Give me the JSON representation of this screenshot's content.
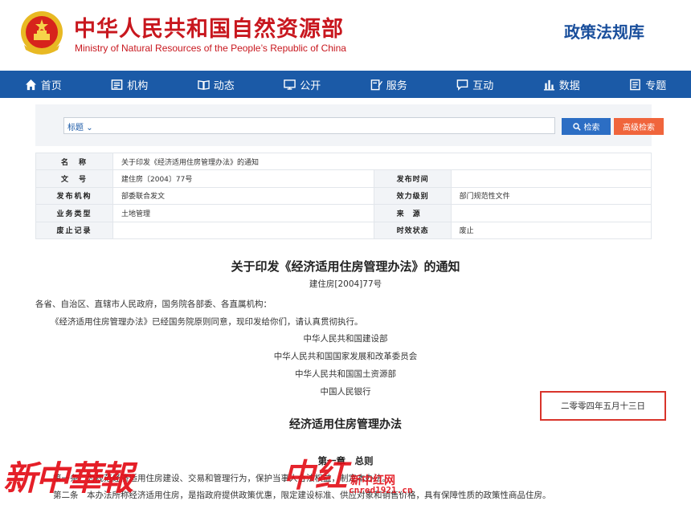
{
  "header": {
    "title_cn": "中华人民共和国自然资源部",
    "title_en": "Ministry of Natural Resources of the People’s Republic of China",
    "site_name": "政策法规库",
    "brand_color": "#c8171e"
  },
  "nav": {
    "color": "#1b5aa7",
    "items": [
      {
        "label": "首页",
        "icon": "home-icon"
      },
      {
        "label": "机构",
        "icon": "org-icon"
      },
      {
        "label": "动态",
        "icon": "book-icon"
      },
      {
        "label": "公开",
        "icon": "monitor-icon"
      },
      {
        "label": "服务",
        "icon": "edit-icon"
      },
      {
        "label": "互动",
        "icon": "chat-icon"
      },
      {
        "label": "数据",
        "icon": "bar-chart-icon"
      },
      {
        "label": "专题",
        "icon": "document-icon"
      }
    ]
  },
  "search": {
    "type_label": "标题",
    "value": "",
    "button_label": "检索",
    "advanced_label": "高级检索"
  },
  "meta": {
    "name_key": "名　称",
    "name_value": "关于印发《经济适用住房管理办法》的通知",
    "docno_key": "文　号",
    "docno_value": "建住房〔2004〕77号",
    "pubtime_key": "发布时间",
    "pubtime_value": "",
    "issuer_key": "发布机构",
    "issuer_value": "部委联合发文",
    "level_key": "效力级别",
    "level_value": "部门规范性文件",
    "biztype_key": "业务类型",
    "biztype_value": "土地管理",
    "source_key": "来　源",
    "source_value": "",
    "abolish_key": "废止记录",
    "abolish_value": "",
    "status_key": "时效状态",
    "status_value": "废止"
  },
  "doc": {
    "title": "关于印发《经济适用住房管理办法》的通知",
    "number": "建住房[2004]77号",
    "salutation": "各省、自治区、直辖市人民政府，国务院各部委、各直属机构：",
    "body": "《经济适用住房管理办法》已经国务院原则同意，现印发给你们，请认真贯彻执行。",
    "signers": [
      "中华人民共和国建设部",
      "中华人民共和国国家发展和改革委员会",
      "中华人民共和国国土资源部",
      "中国人民银行"
    ],
    "date": "二零零四年五月十三日",
    "subtitle": "经济适用住房管理办法",
    "chapter": "第一章　总则",
    "article1": "第一条　为规范经济适用住房建设、交易和管理行为，保护当事人合法权益，制定本办法。",
    "article2": "第二条　本办法所称经济适用住房，是指政府提供政策优惠，限定建设标准、供应对象和销售价格，具有保障性质的政策性商品住房。"
  },
  "watermark": {
    "left": "新中華報",
    "mid": "中红",
    "site": "新中红网",
    "url": "cnred1921.cn"
  }
}
